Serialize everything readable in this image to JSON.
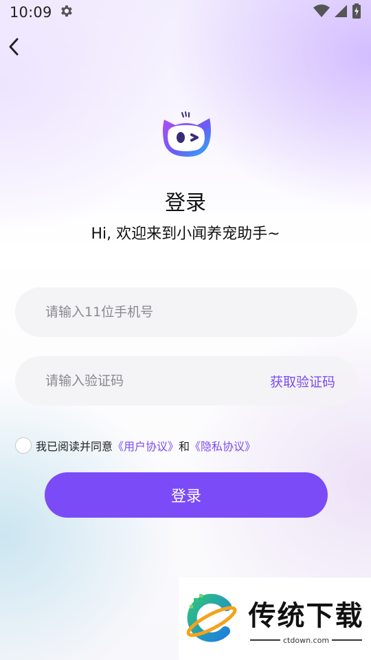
{
  "status_bar": {
    "time": "10:09",
    "icons": [
      "gear-icon",
      "wifi-icon",
      "signal-icon",
      "battery-icon"
    ]
  },
  "header": {
    "back_icon": "chevron-left-icon"
  },
  "app": {
    "logo_icon": "cat-mascot-icon",
    "title": "登录",
    "subtitle": "Hi, 欢迎来到小闻养宠助手~"
  },
  "form": {
    "phone_placeholder": "请输入11位手机号",
    "phone_value": "",
    "code_placeholder": "请输入验证码",
    "code_value": "",
    "get_code_label": "获取验证码"
  },
  "agreement": {
    "prefix": "我已阅读并同意",
    "user_agreement": "《用户协议》",
    "and": "和",
    "privacy_agreement": "《隐私协议》",
    "checked": false
  },
  "login_button_label": "登录",
  "watermark": {
    "title": "传统下载",
    "domain": "ctdown.com"
  },
  "colors": {
    "accent": "#7c4bf8",
    "link": "#7b4bf0",
    "field_bg": "#f3f2f5"
  }
}
